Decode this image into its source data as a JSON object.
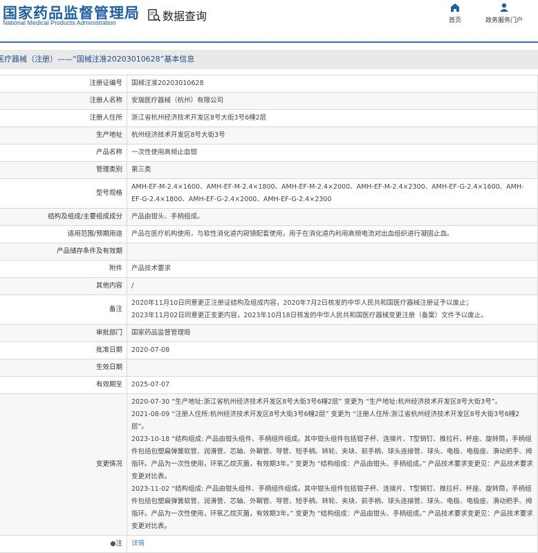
{
  "header": {
    "logo_cn": "国家药品监督管理局",
    "logo_en": "National Medical Products Administration",
    "section": "数据查询",
    "nav": [
      {
        "label": "首页",
        "icon": "home-icon"
      },
      {
        "label": "政务服务门户",
        "icon": "user-icon"
      }
    ]
  },
  "breadcrumb": "医疗器械（注册）——“国械注准20203010628”基本信息",
  "rows": [
    {
      "label": "注册证编号",
      "value": "国械注准20203010628"
    },
    {
      "label": "注册人名称",
      "value": "安瑞医疗器械（杭州）有限公司"
    },
    {
      "label": "注册人住所",
      "value": "浙江省杭州经济技术开发区8号大街3号6幢2层"
    },
    {
      "label": "生产地址",
      "value": "杭州经济技术开发区8号大街3号"
    },
    {
      "label": "产品名称",
      "value": "一次性使用高频止血钳"
    },
    {
      "label": "管理类别",
      "value": "第三类"
    },
    {
      "label": "型号规格",
      "value": "AMH-EF-M-2.4×1600、AMH-EF-M-2.4×1800、AMH-EF-M-2.4×2000、AMH-EF-M-2.4×2300、AMH-EF-G-2.4×1600、AMH-EF-G-2.4×1800、AMH-EF-G-2.4×2000、AMH-EF-G-2.4×2300"
    },
    {
      "label": "结构及组成/主要组成成分",
      "value": "产品由钳头、手柄组成。"
    },
    {
      "label": "适用范围/预期用途",
      "value": "产品在医疗机构使用，与软性消化道内窥镜配套使用，用于在消化道内利用高频电流对出血组织进行凝固止血。"
    },
    {
      "label": "产品储存条件及有效期",
      "value": ""
    },
    {
      "label": "附件",
      "value": "产品技术要求"
    },
    {
      "label": "其他内容",
      "value": "/"
    },
    {
      "label": "备注",
      "lines": [
        "2020年11月10日同意更正注册证结构及组成内容，2020年7月2日核发的中华人民共和国医疗器械注册证予以废止；",
        "2023年11月02日同意更正变更内容，2023年10月18日核发的中华人民共和国医疗器械变更注册（备案）文件予以废止。"
      ]
    },
    {
      "label": "审批部门",
      "value": "国家药品监督管理局"
    },
    {
      "label": "批准日期",
      "value": "2020-07-08"
    },
    {
      "label": "生效日期",
      "value": ""
    },
    {
      "label": "有效期至",
      "value": "2025-07-07"
    },
    {
      "label": "变更情况",
      "lines": [
        "2020-07-30 “生产地址:浙江省杭州经济技术开发区8号大街3号6幢2层” 变更为 “生产地址:杭州经济技术开发区8号大街3号”。",
        "2021-08-09 “注册人住所:杭州经济技术开发区8号大街3号6幢2层” 变更为 “注册人住所:浙江省杭州经济技术开发区8号大街3号6幢2层”。",
        "2023-10-18 “结构组成: 产品由钳头组件、手柄组件组成。其中钳头组件包括钳子杯、连接片、T型销钉、推拉杆、杯座、旋转筒，手柄组件包括包塑扁弹簧软管、润滑管、芯轴、外鞘管、导管、短手柄、转轮、夹块、前手柄、球头连接管、球头、电极、电极座、滑动把手、拇指环。产品为一次性使用，环氧乙烷灭菌，有效期3年。” 变更为 “结构组成：产品由钳头、手柄组成。” 产品技术要求变更见：产品技术要求变更对比表。",
        "2023-11-02 “结构组成: 产品由钳头组件、手柄组件组成。其中钳头组件包括钳子杯、连接片、T型销钉、推拉杆、杯座、旋转筒，手柄组件包括包塑扁弹簧软管、润滑管、芯轴、外鞘管、导管、短手柄、转轮、夹块、前手柄、球头连接管、球头、电极、电极座、滑动把手、拇指环。产品为一次性使用，环氧乙烷灭菌，有效期3年。” 变更为 “结构组成：产品由钳头、手柄组成。” 产品技术要求变更见：产品技术要求变更对比表。"
      ]
    }
  ],
  "note": {
    "label": "注",
    "link": "详情"
  }
}
